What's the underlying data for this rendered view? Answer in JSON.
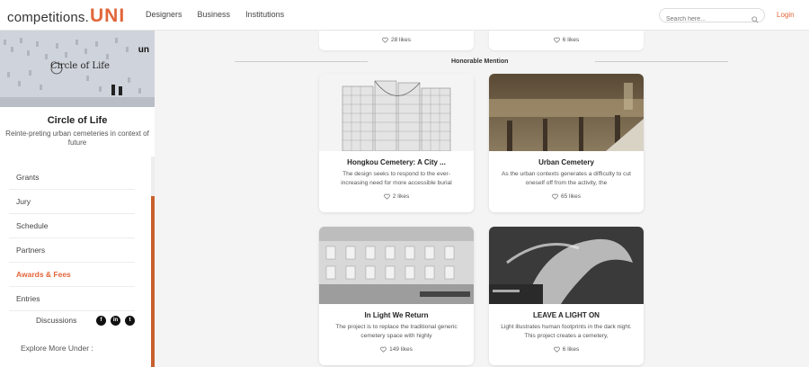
{
  "header": {
    "logo_word": "competitions.",
    "logo_uni": "UNI",
    "nav": [
      "Designers",
      "Business",
      "Institutions"
    ],
    "search_placeholder": "Search here...",
    "login": "Login"
  },
  "sidebar": {
    "hero_overlay": "Circle of Life",
    "hero_badge": "un",
    "title": "Circle of Life",
    "subtitle": "Reinte-preting urban cemeteries in context of future",
    "menu": [
      {
        "label": "Grants",
        "active": false
      },
      {
        "label": "Jury",
        "active": false
      },
      {
        "label": "Schedule",
        "active": false
      },
      {
        "label": "Partners",
        "active": false
      },
      {
        "label": "Awards & Fees",
        "active": true
      },
      {
        "label": "Entries",
        "active": false
      }
    ],
    "discussions": "Discussions",
    "social": [
      "f",
      "in",
      "t"
    ],
    "explore": "Explore More Under :"
  },
  "main": {
    "prev_likes": [
      "28 likes",
      "6 likes"
    ],
    "section_label": "Honorable Mention",
    "cards": [
      {
        "title": "Hongkou Cemetery: A City ...",
        "desc": "The design seeks to respond to the ever-increasing need for more accessible burial",
        "likes": "2 likes"
      },
      {
        "title": "Urban Cemetery",
        "desc": "As the urban contexts generates a difficulty to cut oneself off from the activity, the",
        "likes": "65 likes"
      },
      {
        "title": "In Light We Return",
        "desc": "The project is to replace the traditional generic cemetery space with highly",
        "likes": "149 likes"
      },
      {
        "title": "LEAVE A LIGHT ON",
        "desc": "Light illustrates human footprints in the dark night. This project creates a cemetery,",
        "likes": "6 likes"
      }
    ]
  },
  "colors": {
    "accent": "#e2663a",
    "scrollbar": "#c8602d"
  }
}
